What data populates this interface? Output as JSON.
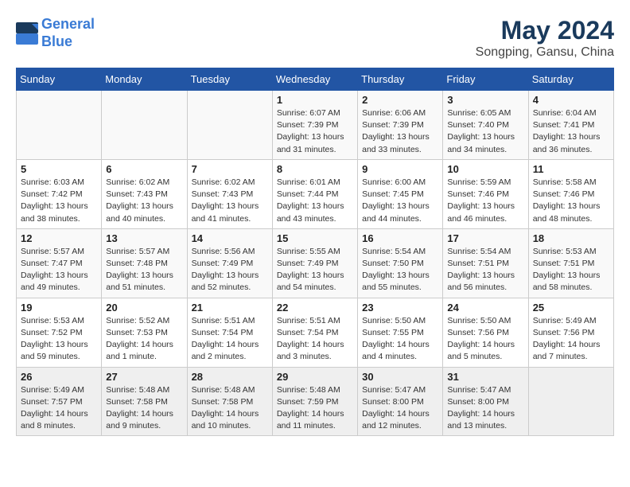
{
  "header": {
    "logo_line1": "General",
    "logo_line2": "Blue",
    "main_title": "May 2024",
    "subtitle": "Songping, Gansu, China"
  },
  "days_of_week": [
    "Sunday",
    "Monday",
    "Tuesday",
    "Wednesday",
    "Thursday",
    "Friday",
    "Saturday"
  ],
  "weeks": [
    [
      {
        "day": "",
        "info": ""
      },
      {
        "day": "",
        "info": ""
      },
      {
        "day": "",
        "info": ""
      },
      {
        "day": "1",
        "info": "Sunrise: 6:07 AM\nSunset: 7:39 PM\nDaylight: 13 hours\nand 31 minutes."
      },
      {
        "day": "2",
        "info": "Sunrise: 6:06 AM\nSunset: 7:39 PM\nDaylight: 13 hours\nand 33 minutes."
      },
      {
        "day": "3",
        "info": "Sunrise: 6:05 AM\nSunset: 7:40 PM\nDaylight: 13 hours\nand 34 minutes."
      },
      {
        "day": "4",
        "info": "Sunrise: 6:04 AM\nSunset: 7:41 PM\nDaylight: 13 hours\nand 36 minutes."
      }
    ],
    [
      {
        "day": "5",
        "info": "Sunrise: 6:03 AM\nSunset: 7:42 PM\nDaylight: 13 hours\nand 38 minutes."
      },
      {
        "day": "6",
        "info": "Sunrise: 6:02 AM\nSunset: 7:43 PM\nDaylight: 13 hours\nand 40 minutes."
      },
      {
        "day": "7",
        "info": "Sunrise: 6:02 AM\nSunset: 7:43 PM\nDaylight: 13 hours\nand 41 minutes."
      },
      {
        "day": "8",
        "info": "Sunrise: 6:01 AM\nSunset: 7:44 PM\nDaylight: 13 hours\nand 43 minutes."
      },
      {
        "day": "9",
        "info": "Sunrise: 6:00 AM\nSunset: 7:45 PM\nDaylight: 13 hours\nand 44 minutes."
      },
      {
        "day": "10",
        "info": "Sunrise: 5:59 AM\nSunset: 7:46 PM\nDaylight: 13 hours\nand 46 minutes."
      },
      {
        "day": "11",
        "info": "Sunrise: 5:58 AM\nSunset: 7:46 PM\nDaylight: 13 hours\nand 48 minutes."
      }
    ],
    [
      {
        "day": "12",
        "info": "Sunrise: 5:57 AM\nSunset: 7:47 PM\nDaylight: 13 hours\nand 49 minutes."
      },
      {
        "day": "13",
        "info": "Sunrise: 5:57 AM\nSunset: 7:48 PM\nDaylight: 13 hours\nand 51 minutes."
      },
      {
        "day": "14",
        "info": "Sunrise: 5:56 AM\nSunset: 7:49 PM\nDaylight: 13 hours\nand 52 minutes."
      },
      {
        "day": "15",
        "info": "Sunrise: 5:55 AM\nSunset: 7:49 PM\nDaylight: 13 hours\nand 54 minutes."
      },
      {
        "day": "16",
        "info": "Sunrise: 5:54 AM\nSunset: 7:50 PM\nDaylight: 13 hours\nand 55 minutes."
      },
      {
        "day": "17",
        "info": "Sunrise: 5:54 AM\nSunset: 7:51 PM\nDaylight: 13 hours\nand 56 minutes."
      },
      {
        "day": "18",
        "info": "Sunrise: 5:53 AM\nSunset: 7:51 PM\nDaylight: 13 hours\nand 58 minutes."
      }
    ],
    [
      {
        "day": "19",
        "info": "Sunrise: 5:53 AM\nSunset: 7:52 PM\nDaylight: 13 hours\nand 59 minutes."
      },
      {
        "day": "20",
        "info": "Sunrise: 5:52 AM\nSunset: 7:53 PM\nDaylight: 14 hours\nand 1 minute."
      },
      {
        "day": "21",
        "info": "Sunrise: 5:51 AM\nSunset: 7:54 PM\nDaylight: 14 hours\nand 2 minutes."
      },
      {
        "day": "22",
        "info": "Sunrise: 5:51 AM\nSunset: 7:54 PM\nDaylight: 14 hours\nand 3 minutes."
      },
      {
        "day": "23",
        "info": "Sunrise: 5:50 AM\nSunset: 7:55 PM\nDaylight: 14 hours\nand 4 minutes."
      },
      {
        "day": "24",
        "info": "Sunrise: 5:50 AM\nSunset: 7:56 PM\nDaylight: 14 hours\nand 5 minutes."
      },
      {
        "day": "25",
        "info": "Sunrise: 5:49 AM\nSunset: 7:56 PM\nDaylight: 14 hours\nand 7 minutes."
      }
    ],
    [
      {
        "day": "26",
        "info": "Sunrise: 5:49 AM\nSunset: 7:57 PM\nDaylight: 14 hours\nand 8 minutes."
      },
      {
        "day": "27",
        "info": "Sunrise: 5:48 AM\nSunset: 7:58 PM\nDaylight: 14 hours\nand 9 minutes."
      },
      {
        "day": "28",
        "info": "Sunrise: 5:48 AM\nSunset: 7:58 PM\nDaylight: 14 hours\nand 10 minutes."
      },
      {
        "day": "29",
        "info": "Sunrise: 5:48 AM\nSunset: 7:59 PM\nDaylight: 14 hours\nand 11 minutes."
      },
      {
        "day": "30",
        "info": "Sunrise: 5:47 AM\nSunset: 8:00 PM\nDaylight: 14 hours\nand 12 minutes."
      },
      {
        "day": "31",
        "info": "Sunrise: 5:47 AM\nSunset: 8:00 PM\nDaylight: 14 hours\nand 13 minutes."
      },
      {
        "day": "",
        "info": ""
      }
    ]
  ]
}
